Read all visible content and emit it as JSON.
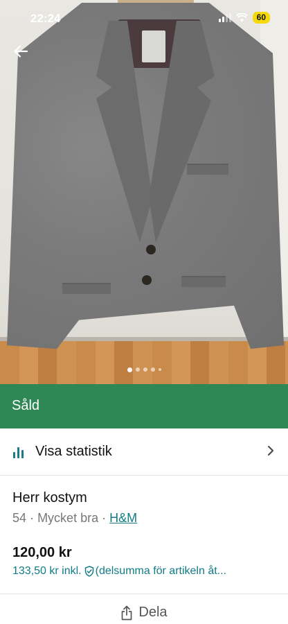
{
  "status_bar": {
    "time": "22:24",
    "battery": "60"
  },
  "gallery": {
    "image_count": 5,
    "active_index": 0
  },
  "sold_banner": {
    "label": "Såld",
    "color": "#2e8754"
  },
  "statistics": {
    "label": "Visa statistik"
  },
  "item": {
    "title": "Herr kostym",
    "size": "54",
    "separator_1": "·",
    "condition": "Mycket bra",
    "separator_2": "·",
    "brand": "H&M",
    "price": "120,00 kr",
    "price_incl": "133,50 kr inkl.",
    "price_incl_note": "(delsumma för artikeln åt..."
  },
  "actions": {
    "share_label": "Dela"
  },
  "colors": {
    "accent": "#127b86",
    "sold_green": "#2e8754"
  }
}
